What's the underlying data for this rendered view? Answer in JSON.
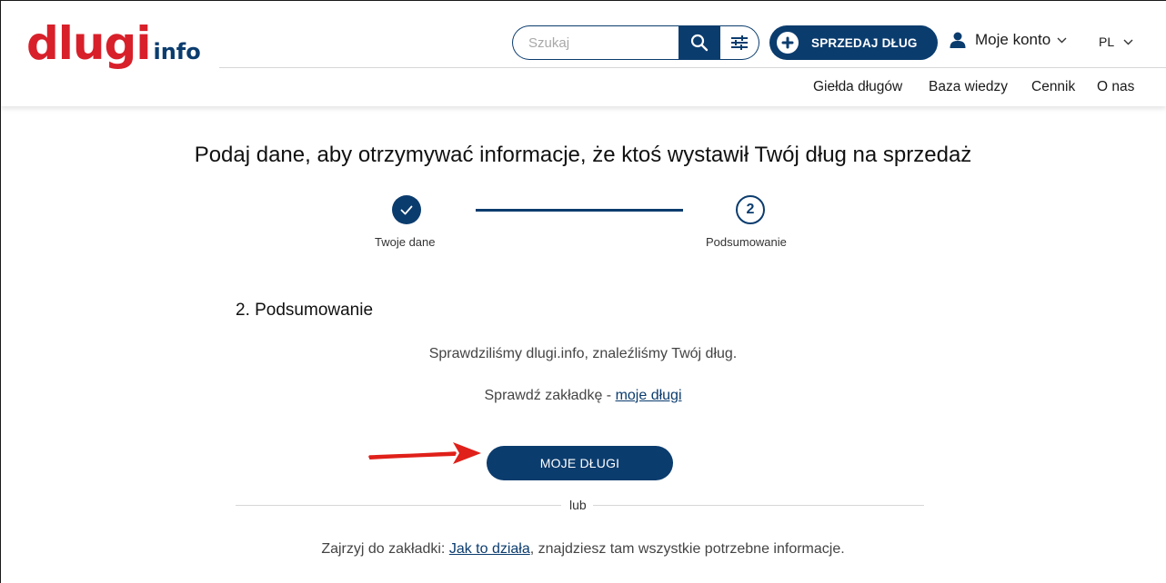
{
  "logo": {
    "main": "dlugi",
    "sub": "info"
  },
  "search": {
    "placeholder": "Szukaj"
  },
  "header": {
    "sell_label": "SPRZEDAJ DŁUG",
    "account_label": "Moje konto",
    "lang_label": "PL"
  },
  "nav": {
    "items": [
      {
        "label": "Giełda długów"
      },
      {
        "label": "Baza wiedzy"
      },
      {
        "label": "Cennik"
      },
      {
        "label": "O nas"
      }
    ]
  },
  "main": {
    "title": "Podaj dane, aby otrzymywać informacje, że ktoś wystawił Twój dług na sprzedaż",
    "steps": [
      {
        "label": "Twoje dane",
        "state": "done"
      },
      {
        "number": "2",
        "label": "Podsumowanie",
        "state": "current"
      }
    ],
    "section_heading": "2. Podsumowanie",
    "info_line_1": "Sprawdziliśmy dlugi.info, znaleźliśmy Twój dług.",
    "info_line_2_prefix": "Sprawdź zakładkę - ",
    "info_line_2_link": "moje długi",
    "button_label": "MOJE DŁUGI",
    "divider_text": "lub",
    "footer_prefix": "Zajrzyj do zakładki: ",
    "footer_link": "Jak to działa",
    "footer_suffix": ", znajdziesz tam wszystkie potrzebne informacje."
  },
  "colors": {
    "primary": "#0b3c6e",
    "logo_red": "#d8202a",
    "annotation_arrow": "#e0201a"
  },
  "icons": [
    "search-icon",
    "filter-icon",
    "plus-icon",
    "user-icon",
    "chevron-down-icon",
    "check-icon",
    "red-arrow-annotation"
  ]
}
